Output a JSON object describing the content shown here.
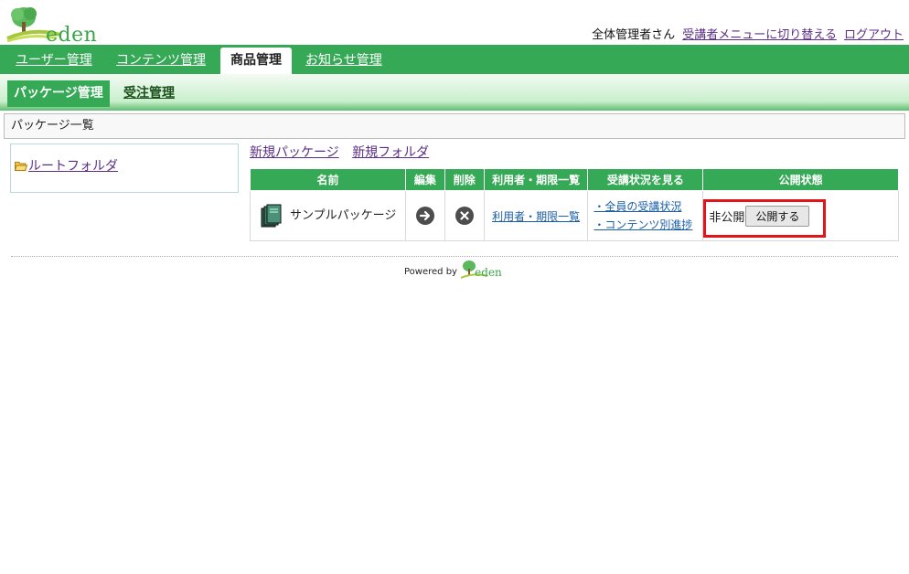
{
  "header": {
    "logo_text": "eden",
    "user_name": "全体管理者さん",
    "switch_link": "受講者メニューに切り替える",
    "logout_link": "ログアウト"
  },
  "main_nav": {
    "tabs": [
      {
        "label": "ユーザー管理"
      },
      {
        "label": "コンテンツ管理"
      },
      {
        "label": "商品管理",
        "active": true
      },
      {
        "label": "お知らせ管理"
      }
    ]
  },
  "sub_nav": {
    "items": [
      {
        "label": "パッケージ管理",
        "active": true
      },
      {
        "label": "受注管理"
      }
    ]
  },
  "page_title": "パッケージ一覧",
  "folder_panel": {
    "root_label": "ルートフォルダ"
  },
  "actions": {
    "new_package": "新規パッケージ",
    "new_folder": "新規フォルダ"
  },
  "table": {
    "headers": [
      "名前",
      "編集",
      "削除",
      "利用者・期限一覧",
      "受講状況を見る",
      "公開状態"
    ],
    "rows": [
      {
        "name": "サンプルパッケージ",
        "users_link": "利用者・期限一覧",
        "status_links": [
          "・全員の受講状況",
          "・コンテンツ別進捗"
        ],
        "publish_state": "非公開",
        "publish_button": "公開する"
      }
    ]
  },
  "footer": {
    "powered_by": "Powered by",
    "logo_text": "eden"
  },
  "colors": {
    "brand_green": "#35a955",
    "link_purple": "#5b2e86",
    "link_blue": "#1a5ea8",
    "highlight_red": "#e3141a"
  }
}
